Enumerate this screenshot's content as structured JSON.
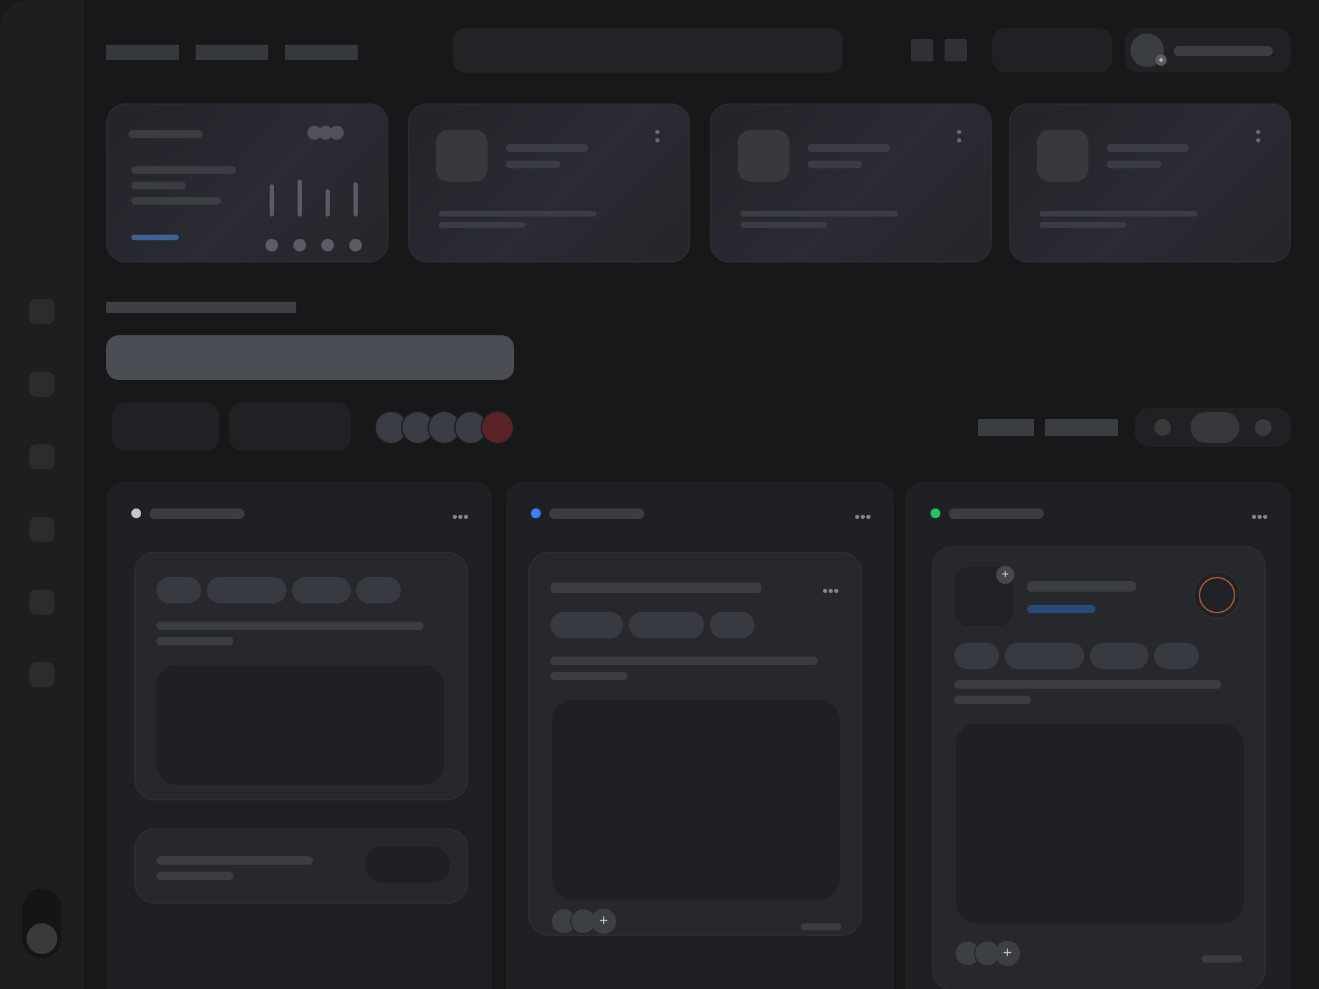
{
  "sidebar": {
    "nav_items": 6
  },
  "header": {
    "tabs": [
      "",
      "",
      ""
    ],
    "search": {
      "placeholder": ""
    }
  },
  "colors": {
    "column_todo": "#c4c7cc",
    "column_in_progress": "#3b82f6",
    "column_done": "#22c55e",
    "equalizer_link": "#3e6196",
    "stack_overflow_avatar": "#5a2326",
    "done_card_subtitle": "#274a78",
    "done_card_ring": "#b0583a"
  },
  "equalizer": {
    "levels": [
      0.65,
      0.75,
      0.55,
      0.7
    ]
  },
  "icons": [
    "plus-icon",
    "kebab-icon",
    "more-horizontal-icon",
    "toggle-knob-icon"
  ]
}
